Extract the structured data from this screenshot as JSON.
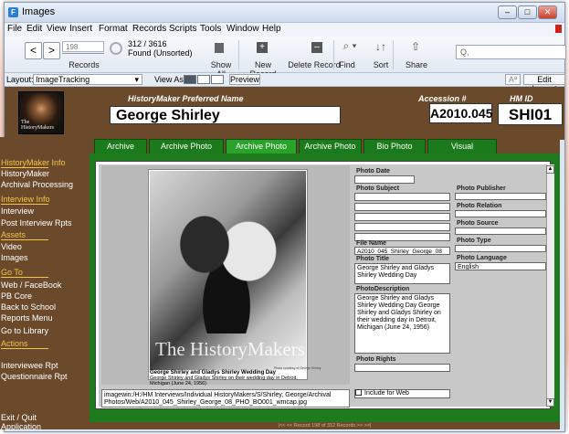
{
  "window": {
    "title": "Images"
  },
  "menu": [
    "File",
    "Edit",
    "View",
    "Insert",
    "Format",
    "Records",
    "Scripts",
    "Tools",
    "Window",
    "Help"
  ],
  "toolbar": {
    "record_input": "198",
    "records_label": "Records",
    "count": "312 / 3616",
    "found": "Found (Unsorted)",
    "show_all": "Show All",
    "new_record": "New Record",
    "delete_record": "Delete Record",
    "find": "Find",
    "sort": "Sort",
    "share": "Share",
    "search_placeholder": "Q,"
  },
  "layoutbar": {
    "layout_label": "Layout:",
    "layout_value": "ImageTracking",
    "view_as": "View As:",
    "preview": "Preview",
    "aa": "Aª",
    "edit_layout": "Edit Layout"
  },
  "header": {
    "preferred_name_label": "HistoryMaker Preferred Name",
    "name": "George Shirley",
    "accession_label": "Accession #",
    "accession": "A2010.045",
    "hmid_label": "HM ID",
    "hmid": "SHI01",
    "portrait_watermark": "The HistoryMakers"
  },
  "tabs": [
    "Archive Photos",
    "Archive Photo Images",
    "Archive Photo Large",
    "Archive Photo Only",
    "Bio Photo Images",
    "Visual Impressions"
  ],
  "sidebar": {
    "h1": "HistoryMaker Info",
    "i1": "HistoryMaker",
    "i2": "Archival Processing",
    "h2": "Interview Info",
    "i3": "Interview",
    "i4": "Post Interview Rpts",
    "h3": "Assets",
    "i5": "Video",
    "i6": "Images",
    "h4": "Go To",
    "i7": "Web   /  FaceBook",
    "i8": "PB Core",
    "i9": "Back to School",
    "i10": "Reports Menu",
    "i11": "Go to Library",
    "h5": "Actions",
    "i12": "Interviewee Rpt",
    "i13": "Questionnaire Rpt",
    "i14": "Exit / Quit",
    "i15": "Application"
  },
  "photo": {
    "watermark": "The HistoryMakers",
    "caption_title": "George Shirley and Gladys Shirley Wedding Day",
    "caption": "George Shirley and Gladys Shirley on their wedding day in Detroit, Michigan (June 24, 1956)",
    "credit": "Photo courtesy of George Shirley",
    "path": "imagewin:/H:/HM Interviews/Individual HistoryMakers/S/Shirley, George/Archival Photos/Web/A2010_045_Shirley_George_08_PHO_BO001_wmcap.jpg"
  },
  "fields": {
    "photo_date_label": "Photo Date",
    "photo_subject_label": "Photo Subject",
    "file_name_label": "File Name",
    "file_name": "A2010_045_Shirley_George_08",
    "photo_title_label": "Photo Title",
    "photo_title": "George Shirley and Gladys Shirley Wedding Day",
    "photo_description_label": "PhotoDescription",
    "photo_description": "George Shirley and Gladys Shirley Wedding Day George Shirley and Gladys Shirley on their wedding day in Detroit, Michigan (June 24, 1956)",
    "photo_rights_label": "Photo Rights",
    "include_web": "Include for Web",
    "publisher_label": "Photo Publisher",
    "relation_label": "Photo Relation",
    "source_label": "Photo Source",
    "type_label": "Photo Type",
    "language_label": "Photo Language",
    "language": "English"
  },
  "status": {
    "text": "|<<    <<    Record  198  of  312  Records    >>    >>|"
  }
}
